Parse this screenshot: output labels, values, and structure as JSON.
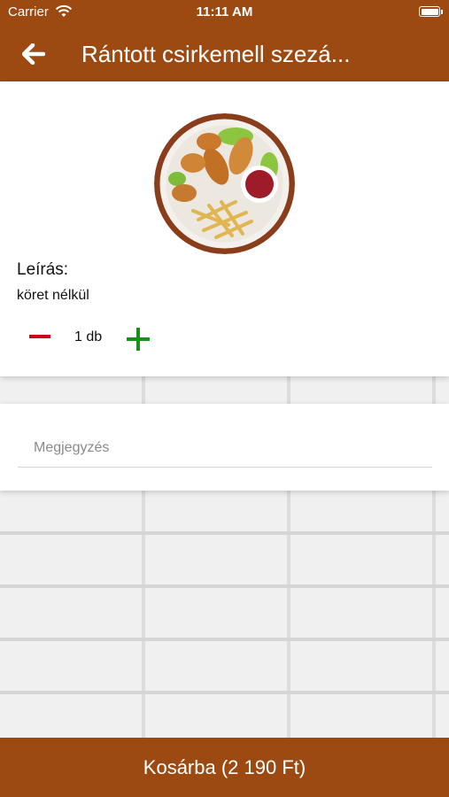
{
  "status_bar": {
    "carrier": "Carrier",
    "time": "11:11 AM"
  },
  "header": {
    "title": "Rántott csirkemell szezá...",
    "back_icon": "arrow-left-icon"
  },
  "product": {
    "image_icon": "food-plate-image",
    "description_label": "Leírás:",
    "description_text": "köret nélkül",
    "quantity": "1 db"
  },
  "note": {
    "placeholder": "Megjegyzés",
    "value": ""
  },
  "cart_button": {
    "label": "Kosárba (2 190 Ft)"
  },
  "colors": {
    "brand": "#9c4a12",
    "minus": "#d0021b",
    "plus": "#1a8f1a"
  }
}
